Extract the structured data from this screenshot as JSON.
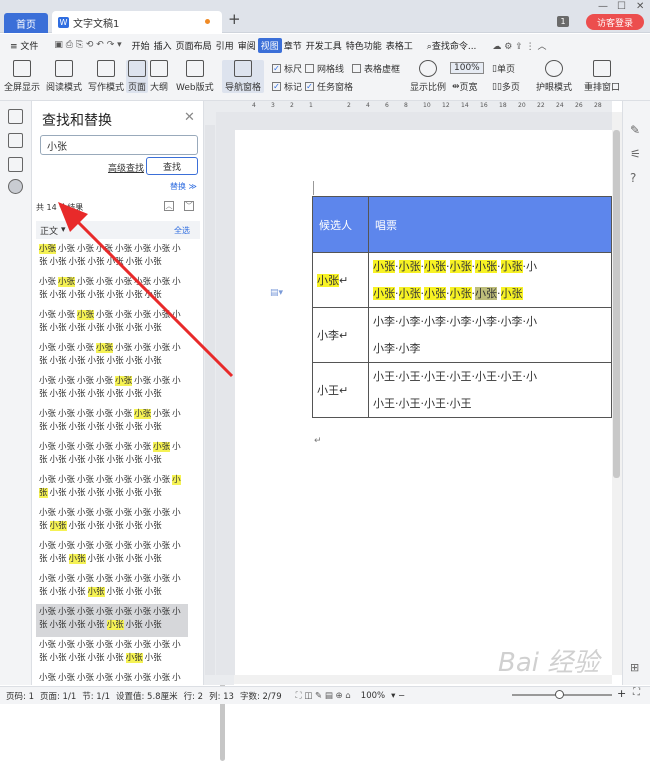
{
  "titlebar": {
    "home_tab": "首页",
    "doc_tab": "文字文稿1",
    "badge": "1",
    "guest_login": "访客登录"
  },
  "menu": {
    "file": "≡ 文件",
    "items": [
      "开始",
      "插入",
      "页面布局",
      "引用",
      "审阅",
      "视图",
      "章节",
      "开发工具",
      "特色功能",
      "表格工"
    ],
    "active": "视图",
    "search": "查找命令..."
  },
  "toolbar": {
    "buttons": [
      "全屏显示",
      "阅读模式",
      "写作模式",
      "页面",
      "大纲",
      "Web版式",
      "导航窗格",
      "显示比例",
      "100%",
      "页宽",
      "单页",
      "多页",
      "护眼模式",
      "重排窗口"
    ],
    "checks": [
      {
        "label": "标尺",
        "checked": true
      },
      {
        "label": "网格线",
        "checked": false
      },
      {
        "label": "表格虚框",
        "checked": false
      },
      {
        "label": "标记",
        "checked": true
      },
      {
        "label": "任务窗格",
        "checked": true
      }
    ]
  },
  "panel": {
    "title": "查找和替换",
    "search_value": "小张",
    "advanced": "高级查找",
    "find": "查找",
    "replace": "替换 ≫",
    "count": "共 14 个结果",
    "section": "正文",
    "select_all": "全选",
    "results": [
      {
        "hit": 0
      },
      {
        "hit": 1
      },
      {
        "hit": 2
      },
      {
        "hit": 3
      },
      {
        "hit": 4
      },
      {
        "hit": 5
      },
      {
        "hit": 6
      },
      {
        "hit": 7
      },
      {
        "hit": 8
      },
      {
        "hit": 9
      },
      {
        "hit": 10
      },
      {
        "hit": 11
      },
      {
        "hit": 12
      },
      {
        "hit": 13
      }
    ],
    "word": "小张"
  },
  "ruler": {
    "h": [
      "4",
      "3",
      "2",
      "1",
      "",
      "2",
      "4",
      "6",
      "8",
      "10",
      "12",
      "14",
      "16",
      "18",
      "20",
      "22",
      "24",
      "26",
      "28"
    ]
  },
  "document": {
    "table": {
      "header": [
        "候选人",
        "唱票"
      ],
      "rows": [
        {
          "name": "小张",
          "line1": "小张·小张·小张·小张·小张·小张·小",
          "line2": "小张·小张·小张·小张·小张·小张"
        },
        {
          "name": "小李",
          "line1": "小李·小李·小李·小李·小李·小李·小",
          "line2": "小李·小李"
        },
        {
          "name": "小王",
          "line1": "小王·小王·小王·小王·小王·小王·小",
          "line2": "小王·小王·小王·小王"
        }
      ]
    }
  },
  "status": {
    "page": "页码: 1",
    "pages": "页面: 1/1",
    "section": "节: 1/1",
    "setting": "设置值: 5.8厘米",
    "row": "行: 2",
    "col": "列: 13",
    "words": "字数: 2/79",
    "zoom": "100%"
  },
  "watermark": "Bai 经验"
}
